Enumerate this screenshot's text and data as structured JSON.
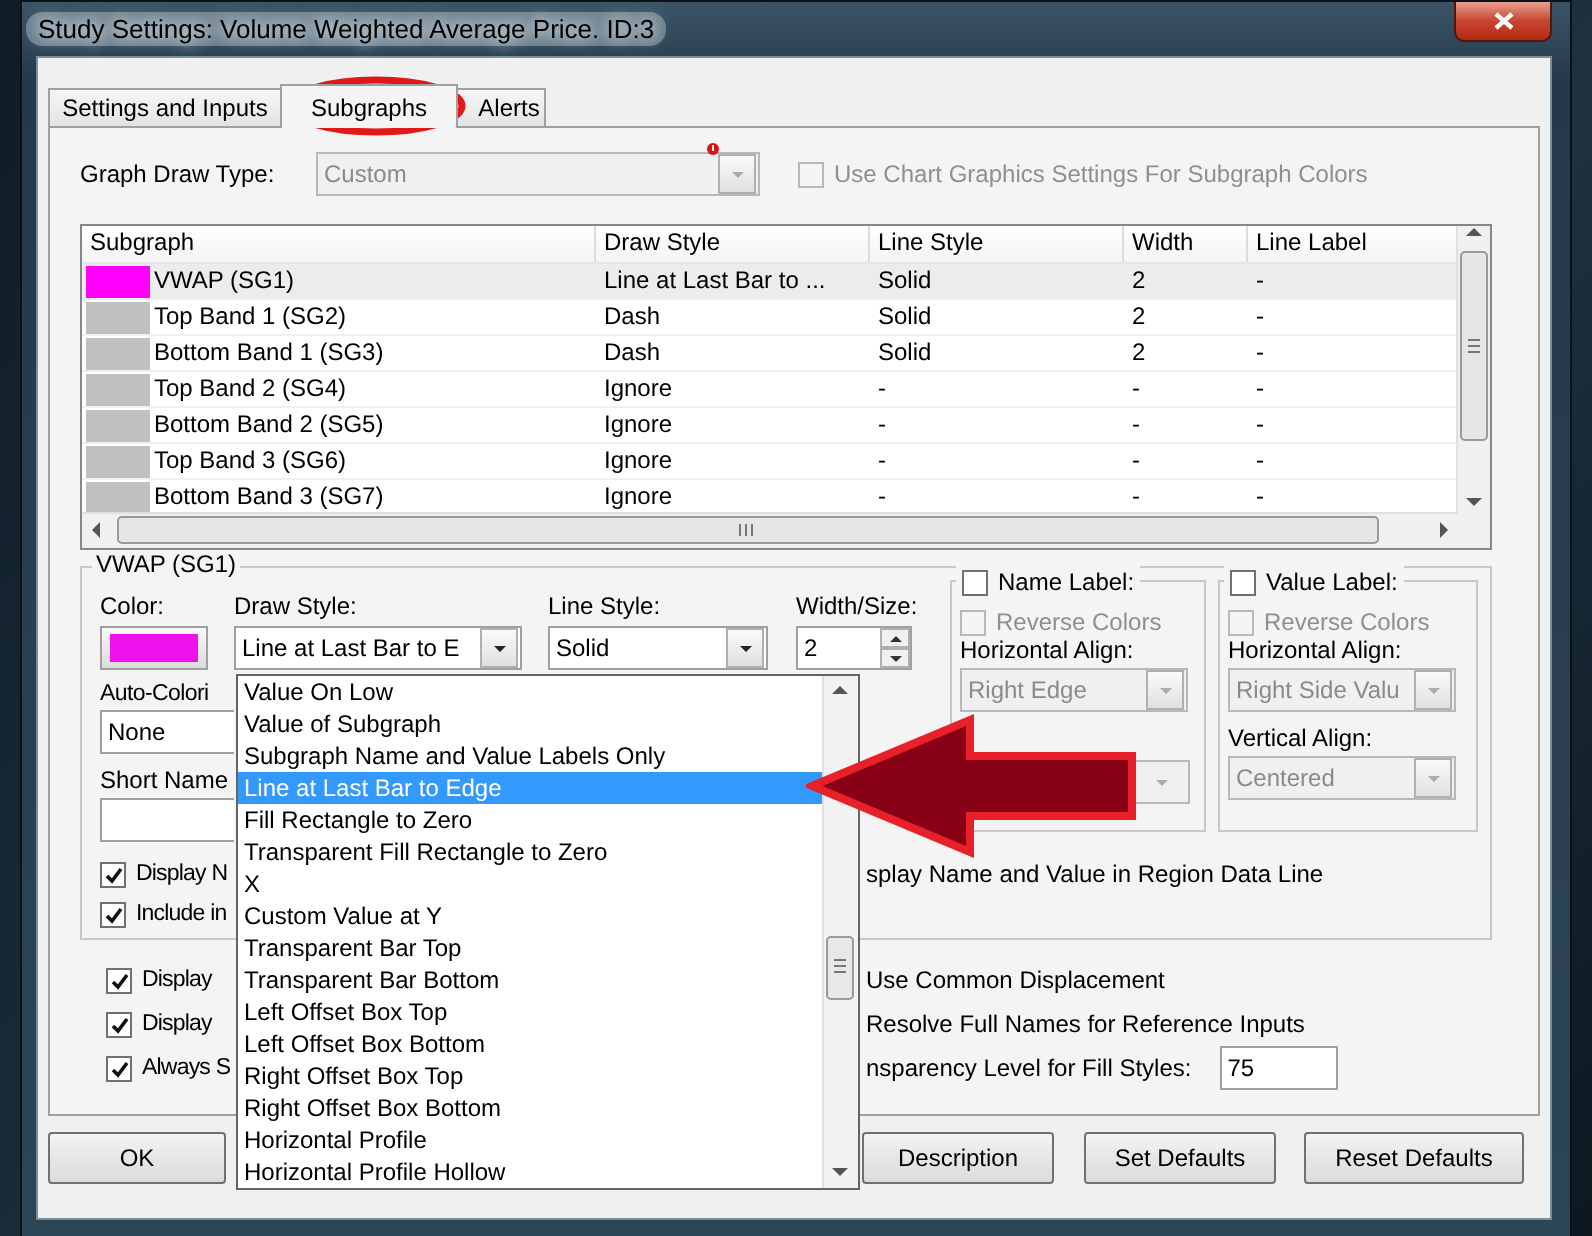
{
  "window": {
    "title": "Study Settings: Volume Weighted Average Price. ID:3"
  },
  "tabs": [
    {
      "label": "Settings and Inputs",
      "selected": false
    },
    {
      "label": "Subgraphs",
      "selected": true
    },
    {
      "label": "Alerts",
      "selected": false
    }
  ],
  "graph_draw_type": {
    "label": "Graph Draw Type:",
    "value": "Custom",
    "disabled": true
  },
  "chart_colors_option": {
    "label": "Use Chart Graphics Settings For Subgraph Colors",
    "checked": false,
    "disabled": true
  },
  "subgraph_table": {
    "columns": [
      "Subgraph",
      "Draw Style",
      "Line Style",
      "Width",
      "Line Label"
    ],
    "rows": [
      {
        "color": "#ff00ff",
        "cells": [
          "VWAP (SG1)",
          "Line at Last Bar to ...",
          "Solid",
          "2",
          "-"
        ],
        "selected": true
      },
      {
        "color": "#c0c0c0",
        "cells": [
          "Top Band 1 (SG2)",
          "Dash",
          "Solid",
          "2",
          "-"
        ],
        "selected": false
      },
      {
        "color": "#c0c0c0",
        "cells": [
          "Bottom Band 1 (SG3)",
          "Dash",
          "Solid",
          "2",
          "-"
        ],
        "selected": false
      },
      {
        "color": "#c0c0c0",
        "cells": [
          "Top Band 2 (SG4)",
          "Ignore",
          "-",
          "-",
          "-"
        ],
        "selected": false
      },
      {
        "color": "#c0c0c0",
        "cells": [
          "Bottom Band 2 (SG5)",
          "Ignore",
          "-",
          "-",
          "-"
        ],
        "selected": false
      },
      {
        "color": "#c0c0c0",
        "cells": [
          "Top Band 3 (SG6)",
          "Ignore",
          "-",
          "-",
          "-"
        ],
        "selected": false
      },
      {
        "color": "#c0c0c0",
        "cells": [
          "Bottom Band 3 (SG7)",
          "Ignore",
          "-",
          "-",
          "-"
        ],
        "selected": false
      }
    ]
  },
  "subgraph_group": {
    "title": "VWAP (SG1)",
    "color_label": "Color:",
    "color": "#ee11ee",
    "draw_style": {
      "label": "Draw Style:",
      "value": "Line at Last Bar to E"
    },
    "line_style": {
      "label": "Line Style:",
      "value": "Solid"
    },
    "width": {
      "label": "Width/Size:",
      "value": "2"
    },
    "auto_coloring": {
      "label": "Auto-Colori",
      "value": "None"
    },
    "short_name": {
      "label": "Short Name"
    },
    "name_label": {
      "label": "Name Label:",
      "checked": false,
      "reverse_colors": {
        "label": "Reverse Colors",
        "checked": false,
        "disabled": true
      },
      "horizontal_align": {
        "label": "Horizontal Align:",
        "value": "Right Edge"
      }
    },
    "value_label": {
      "label": "Value Label:",
      "checked": false,
      "reverse_colors": {
        "label": "Reverse Colors",
        "checked": false,
        "disabled": true
      },
      "horizontal_align": {
        "label": "Horizontal Align:",
        "value": "Right Side Valu"
      },
      "vertical_align": {
        "label": "Vertical Align:",
        "value": "Centered"
      }
    },
    "checks": [
      {
        "label": "Display N",
        "checked": true,
        "note": "splay Name and Value in Region Data Line"
      },
      {
        "label": "Include in",
        "checked": true
      }
    ]
  },
  "options": [
    {
      "label": "Display",
      "checked": true,
      "right": {
        "kind": "text",
        "label": "Use Common Displacement"
      }
    },
    {
      "label": "Display",
      "checked": true,
      "right": {
        "kind": "text",
        "label": "Resolve Full Names for Reference Inputs"
      }
    },
    {
      "label": "Always S",
      "checked": true,
      "right": {
        "kind": "field",
        "label": "nsparency Level for Fill Styles:",
        "value": "75"
      }
    }
  ],
  "draw_style_list": {
    "items": [
      {
        "label": "Value On Low",
        "selected": false
      },
      {
        "label": "Value of Subgraph",
        "selected": false
      },
      {
        "label": "Subgraph Name and Value Labels Only",
        "selected": false
      },
      {
        "label": "Line at Last Bar to Edge",
        "selected": true
      },
      {
        "label": "Fill Rectangle to Zero",
        "selected": false
      },
      {
        "label": "Transparent Fill Rectangle to Zero",
        "selected": false
      },
      {
        "label": "X",
        "selected": false
      },
      {
        "label": "Custom Value at Y",
        "selected": false
      },
      {
        "label": "Transparent Bar Top",
        "selected": false
      },
      {
        "label": "Transparent Bar Bottom",
        "selected": false
      },
      {
        "label": "Left Offset Box Top",
        "selected": false
      },
      {
        "label": "Left Offset Box Bottom",
        "selected": false
      },
      {
        "label": "Right Offset Box Top",
        "selected": false
      },
      {
        "label": "Right Offset Box Bottom",
        "selected": false
      },
      {
        "label": "Horizontal Profile",
        "selected": false
      },
      {
        "label": "Horizontal Profile Hollow",
        "selected": false
      }
    ]
  },
  "buttons": [
    {
      "label": "OK",
      "kind": "left"
    },
    {
      "label": "Description",
      "kind": "right"
    },
    {
      "label": "Set Defaults",
      "kind": "right"
    },
    {
      "label": "Reset Defaults",
      "kind": "right"
    }
  ]
}
